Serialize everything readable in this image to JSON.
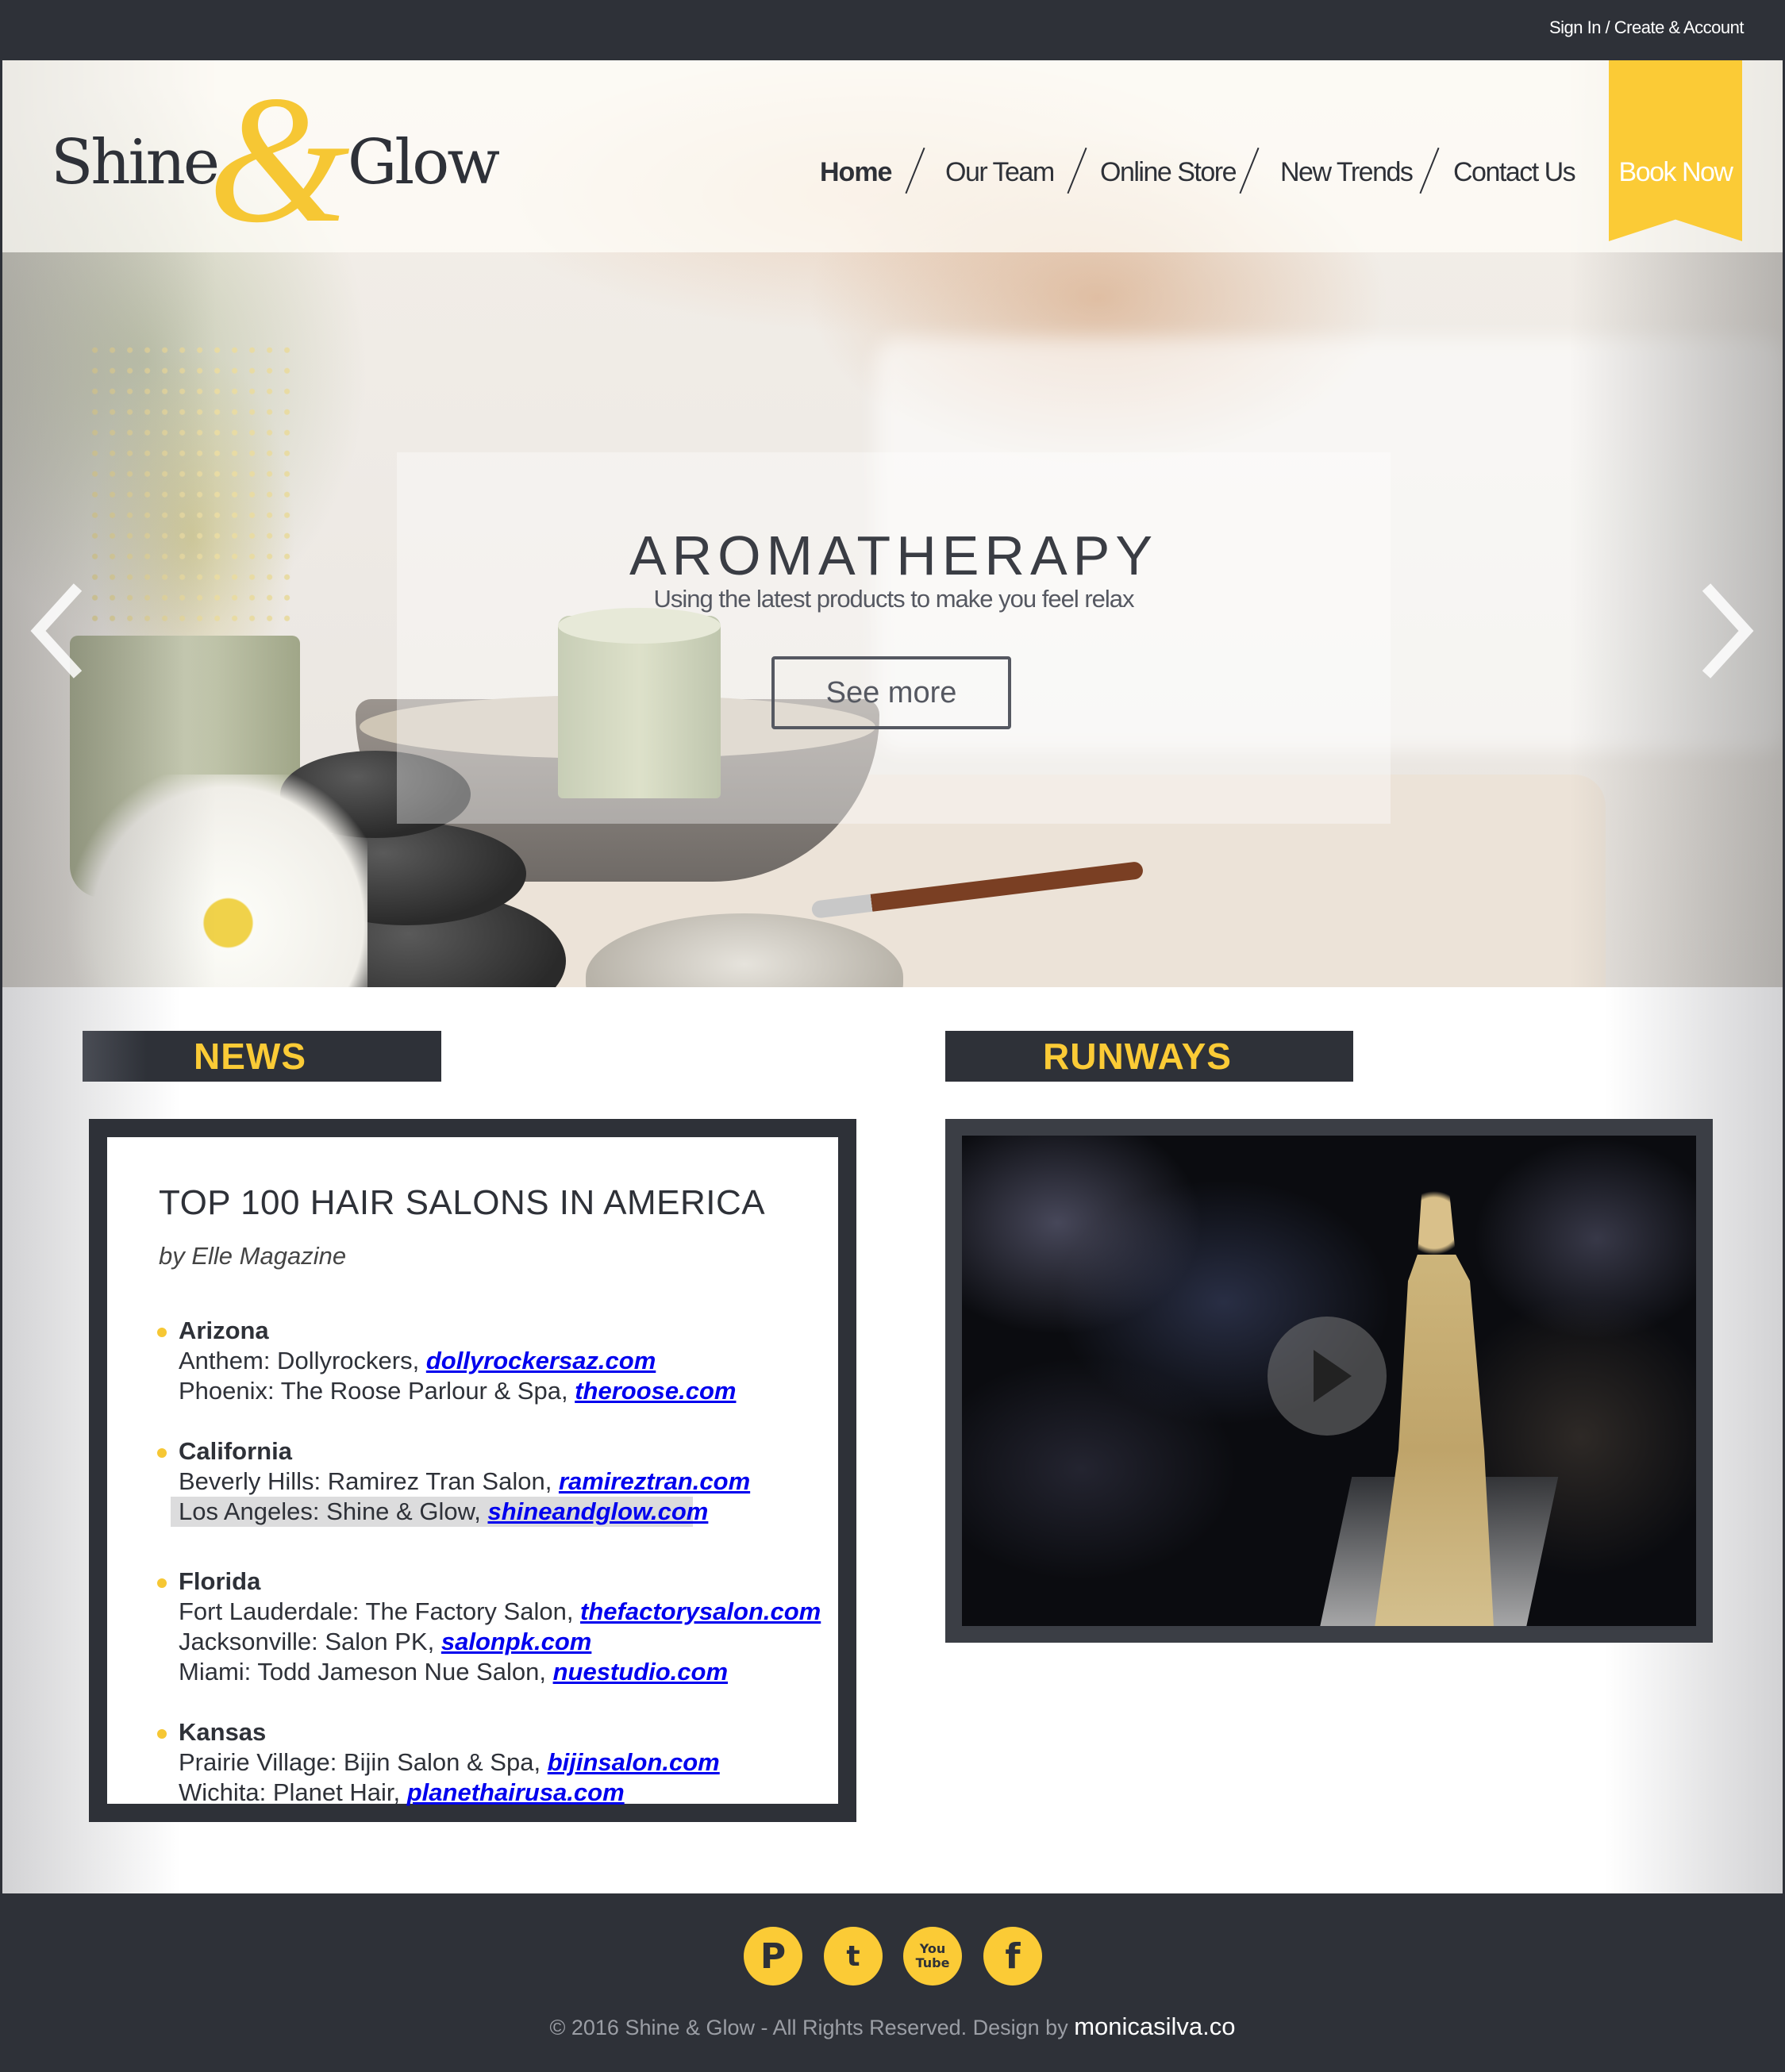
{
  "topbar": {
    "signin_label": "Sign In / Create & Account"
  },
  "brand": {
    "word1": "Shine",
    "ampersand": "&",
    "word2": "Glow"
  },
  "nav": {
    "items": [
      "Home",
      "Our Team",
      "Online Store",
      "New Trends",
      "Contact Us"
    ],
    "active": "Home",
    "book_label": "Book Now"
  },
  "slider": {
    "title": "AROMATHERAPY",
    "subtitle": "Using the latest products to make you feel relax",
    "button_label": "See more"
  },
  "news": {
    "heading": "NEWS",
    "article_title": "TOP 100 HAIR SALONS IN AMERICA",
    "byline": "by Elle Magazine",
    "states": [
      {
        "name": "Arizona",
        "salons": [
          {
            "city_name": "Anthem: Dollyrockers",
            "sep": ", ",
            "site": "dollyrockersaz.com"
          },
          {
            "city_name": "Phoenix: The Roose Parlour & Spa",
            "sep": ", ",
            "site": "theroose.com"
          }
        ]
      },
      {
        "name": "California",
        "salons": [
          {
            "city_name": "Beverly Hills: Ramirez Tran Salon",
            "sep": ", ",
            "site": "ramireztran.com"
          },
          {
            "city_name": "Los Angeles: Shine & Glow",
            "sep": ", ",
            "site": "shineandglow.com"
          }
        ]
      },
      {
        "name": "Florida",
        "salons": [
          {
            "city_name": "Fort Lauderdale: The Factory Salon",
            "sep": ", ",
            "site": "thefactorysalon.com"
          },
          {
            "city_name": "Jacksonville: Salon PK",
            "sep": ", ",
            "site": "salonpk.com"
          },
          {
            "city_name": "Miami: Todd Jameson Nue Salon",
            "sep": ", ",
            "site": "nuestudio.com"
          }
        ]
      },
      {
        "name": "Kansas",
        "salons": [
          {
            "city_name": "Prairie Village: Bijin Salon & Spa",
            "sep": ", ",
            "site": "bijinsalon.com"
          },
          {
            "city_name": "Wichita: Planet Hair",
            "sep": ", ",
            "site": "planethairusa.com"
          }
        ]
      }
    ]
  },
  "runways": {
    "heading": "RUNWAYS"
  },
  "footer": {
    "social": [
      {
        "name": "pinterest",
        "glyph": "P"
      },
      {
        "name": "twitter",
        "glyph": "t"
      },
      {
        "name": "youtube",
        "glyph": "You\nTube"
      },
      {
        "name": "facebook",
        "glyph": "f"
      }
    ],
    "copyright": "© 2016 Shine & Glow - All Rights Reserved. Design by ",
    "credit": "monicasilva.co"
  },
  "colors": {
    "accent": "#fbcb36",
    "dark": "#2e3138",
    "highlight": "#dcdcdd"
  }
}
